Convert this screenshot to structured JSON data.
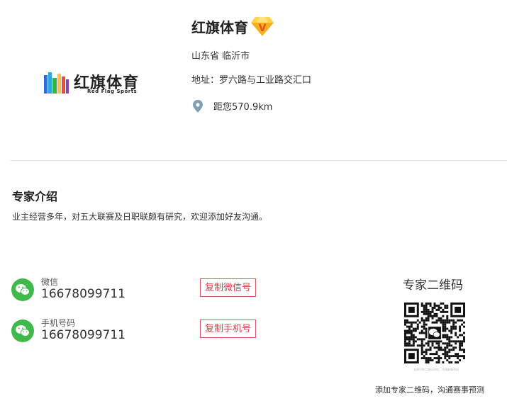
{
  "header": {
    "logo_text": "红旗体育",
    "logo_subtext": "Red Flag Sports",
    "title": "红旗体育",
    "vip_badge_letter": "V",
    "region": "山东省 临沂市",
    "address": "地址：罗六路与工业路交汇口",
    "distance": "距您570.9km"
  },
  "intro": {
    "title": "专家介绍",
    "text": "业主经营多年，对五大联赛及日职联颇有研究，欢迎添加好友沟通。"
  },
  "contacts": [
    {
      "label": "微信",
      "value": "16678099711",
      "button": "复制微信号"
    },
    {
      "label": "手机号码",
      "value": "16678099711",
      "button": "复制手机号"
    }
  ],
  "qr": {
    "title": "专家二维码",
    "tiny_text": "长按识别二维码添加，沟通赛事预测",
    "caption": "添加专家二维码，沟通赛事预测"
  },
  "colors": {
    "accent_red": "#d43f49",
    "wechat_green": "#3fba4a",
    "vip_gold": "#f5b020"
  }
}
